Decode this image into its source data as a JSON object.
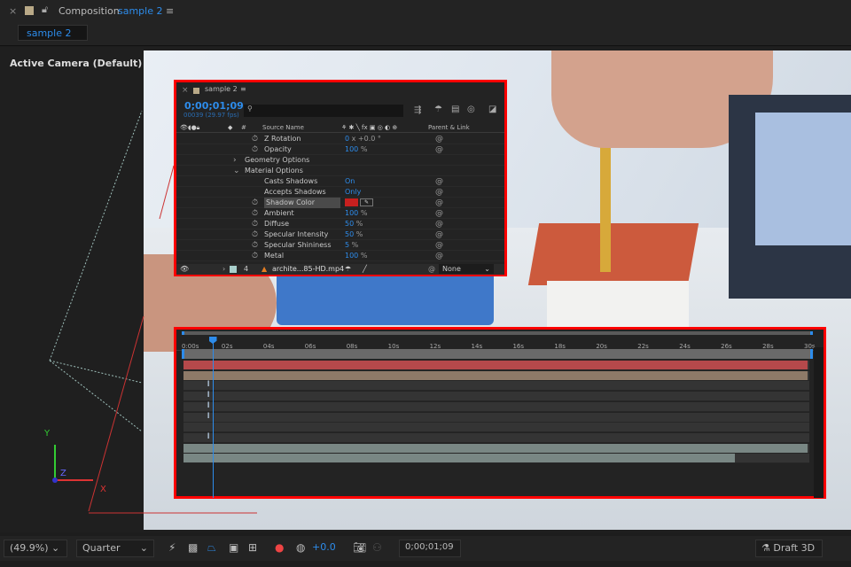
{
  "header": {
    "close": "×",
    "title_prefix": "Composition",
    "comp_name": "sample 2",
    "menu": "≡"
  },
  "tab": {
    "label": "sample 2"
  },
  "viewer": {
    "camera_label": "Active Camera (Default)",
    "axis_y": "Y",
    "axis_z": "Z",
    "axis_x": "X"
  },
  "layers_panel": {
    "tab_close": "×",
    "tab_label": "sample 2",
    "menu": "≡",
    "timecode": "0;00;01;09",
    "frame_info": "00039 (29.97 fps)",
    "search_placeholder": "",
    "col_source": "Source Name",
    "col_num": "#",
    "col_switches": "⚘ ✱ ╲ fx ▣ ◎ ◐ ⊕",
    "col_parent": "Parent & Link",
    "rows": [
      {
        "label": "Z Rotation",
        "value": "0",
        "suffix": " x +0.0 °",
        "stopwatch": true,
        "indent": 1
      },
      {
        "label": "Opacity",
        "value": "100",
        "suffix": " %",
        "stopwatch": true,
        "indent": 1
      },
      {
        "label": "Geometry Options",
        "value": "",
        "suffix": "",
        "stopwatch": false,
        "indent": 0,
        "twirl": "›"
      },
      {
        "label": "Material Options",
        "value": "",
        "suffix": "",
        "stopwatch": false,
        "indent": 0,
        "twirl": "⌄"
      },
      {
        "label": "Casts Shadows",
        "value": "On",
        "suffix": "",
        "stopwatch": false,
        "indent": 1
      },
      {
        "label": "Accepts Shadows",
        "value": "Only",
        "suffix": "",
        "stopwatch": false,
        "indent": 1
      },
      {
        "label": "Shadow Color",
        "value": "",
        "suffix": "",
        "stopwatch": true,
        "indent": 1,
        "color": "#c8201f"
      },
      {
        "label": "Ambient",
        "value": "100",
        "suffix": " %",
        "stopwatch": true,
        "indent": 1
      },
      {
        "label": "Diffuse",
        "value": "50",
        "suffix": " %",
        "stopwatch": true,
        "indent": 1
      },
      {
        "label": "Specular Intensity",
        "value": "50",
        "suffix": " %",
        "stopwatch": true,
        "indent": 1
      },
      {
        "label": "Specular Shininess",
        "value": "5",
        "suffix": " %",
        "stopwatch": true,
        "indent": 1
      },
      {
        "label": "Metal",
        "value": "100",
        "suffix": " %",
        "stopwatch": true,
        "indent": 1
      }
    ],
    "layer": {
      "number": "4",
      "name": "archite...85-HD.mp4",
      "parent": "None",
      "label_color": "#a9d0cc"
    }
  },
  "timeline": {
    "ticks": [
      "0:00s",
      "02s",
      "04s",
      "06s",
      "08s",
      "10s",
      "12s",
      "14s",
      "16s",
      "18s",
      "20s",
      "22s",
      "24s",
      "26s",
      "28s",
      "30s"
    ],
    "playhead_seconds": 1.3,
    "duration_seconds": 30,
    "bars": [
      {
        "color": "#b5494b",
        "start": 0,
        "end": 30
      },
      {
        "color": "#8e7a68",
        "start": 0,
        "end": 30
      },
      {
        "color": null
      },
      {
        "color": null
      },
      {
        "color": null
      },
      {
        "color": null
      },
      {
        "color": null
      },
      {
        "color": null
      },
      {
        "color": "#798784",
        "start": 0,
        "end": 30
      },
      {
        "color": "#798784",
        "start": 0,
        "end": 26.5
      }
    ],
    "keyframe_rows": [
      2,
      3,
      4,
      5,
      7
    ]
  },
  "bottom": {
    "zoom": "(49.9%)",
    "resolution": "Quarter",
    "exposure": "+0.0",
    "timecode": "0;00;01;09",
    "renderer": "Draft 3D"
  },
  "colors": {
    "accent": "#2d8ceb",
    "highlight_border": "#ff0000"
  }
}
